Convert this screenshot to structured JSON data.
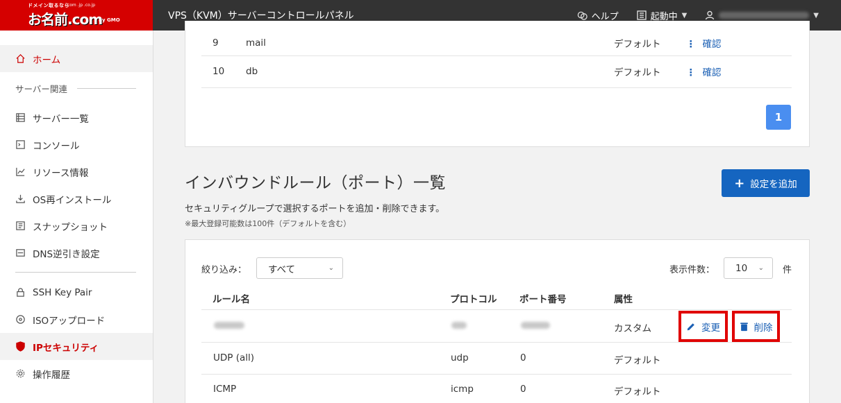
{
  "header": {
    "logo_tag": "ドメイン取るなら",
    "logo_main": "お名前.com",
    "logo_domains": ".com .jp .co.jp",
    "logo_sub": "by GMO",
    "title": "VPS（KVM）サーバーコントロールパネル",
    "help_label": "ヘルプ",
    "status_label": "起動中"
  },
  "sidebar": {
    "home": "ホーム",
    "section_label": "サーバー関連",
    "items": [
      {
        "label": "サーバー一覧"
      },
      {
        "label": "コンソール"
      },
      {
        "label": "リソース情報"
      },
      {
        "label": "OS再インストール"
      },
      {
        "label": "スナップショット"
      },
      {
        "label": "DNS逆引き設定"
      }
    ],
    "items2": [
      {
        "label": "SSH Key Pair"
      },
      {
        "label": "ISOアップロード"
      },
      {
        "label": "IPセキュリティ"
      },
      {
        "label": "操作履歴"
      }
    ]
  },
  "top_table": {
    "rows": [
      {
        "no": "9",
        "name": "mail",
        "attr": "デフォルト",
        "action": "確認"
      },
      {
        "no": "10",
        "name": "db",
        "attr": "デフォルト",
        "action": "確認"
      }
    ],
    "page": "1"
  },
  "inbound": {
    "title": "インバウンドルール（ポート）一覧",
    "add_button": "設定を追加",
    "description": "セキュリティグループで選択するポートを追加・削除できます。",
    "note": "※最大登録可能数は100件（デフォルトを含む）",
    "filter_label": "絞り込み：",
    "filter_value": "すべて",
    "per_page_label": "表示件数：",
    "per_page_value": "10",
    "per_page_unit": "件",
    "columns": {
      "name": "ルール名",
      "protocol": "プロトコル",
      "port": "ポート番号",
      "attr": "属性"
    },
    "rows": [
      {
        "name": "",
        "protocol": "",
        "port": "",
        "attr": "カスタム",
        "edit": "変更",
        "delete": "削除"
      },
      {
        "name": "UDP (all)",
        "protocol": "udp",
        "port": "0",
        "attr": "デフォルト"
      },
      {
        "name": "ICMP",
        "protocol": "icmp",
        "port": "0",
        "attr": "デフォルト"
      }
    ]
  }
}
